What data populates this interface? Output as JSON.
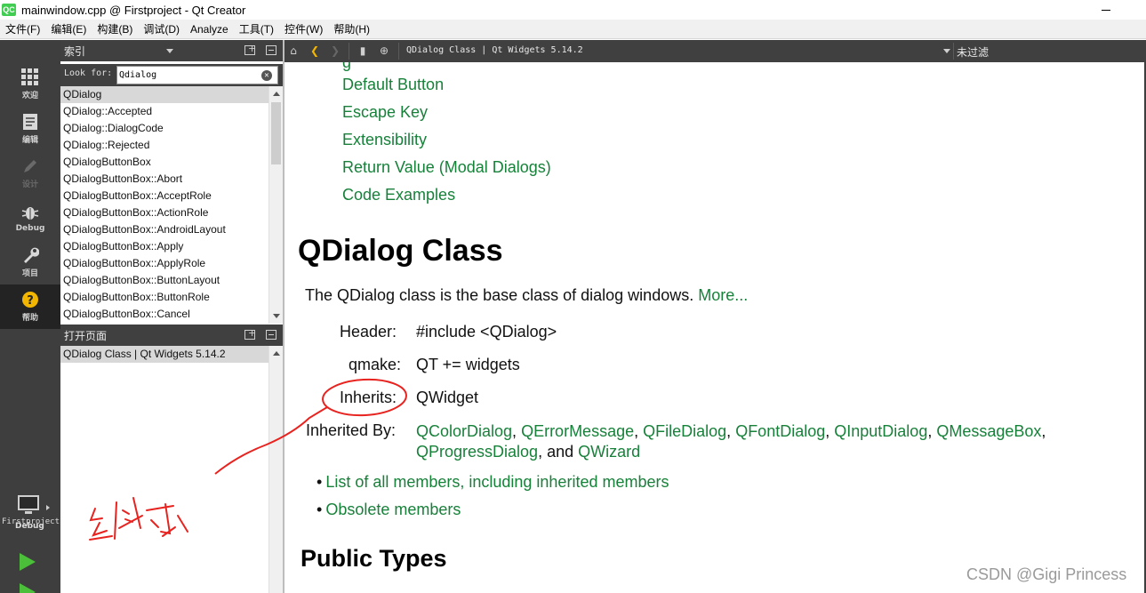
{
  "window": {
    "logo": "QC",
    "title": "mainwindow.cpp @ Firstproject - Qt Creator"
  },
  "menu": [
    "文件(F)",
    "编辑(E)",
    "构建(B)",
    "调试(D)",
    "Analyze",
    "工具(T)",
    "控件(W)",
    "帮助(H)"
  ],
  "modes": [
    {
      "label": "欢迎",
      "icon": "grid-icon"
    },
    {
      "label": "编辑",
      "icon": "document-icon"
    },
    {
      "label": "设计",
      "icon": "pencil-icon"
    },
    {
      "label": "Debug",
      "icon": "bug-icon"
    },
    {
      "label": "项目",
      "icon": "wrench-icon"
    },
    {
      "label": "帮助",
      "icon": "help-icon"
    }
  ],
  "target": {
    "project": "Firstproject",
    "build": "Debug"
  },
  "index_panel": {
    "title": "索引",
    "look_for_label": "Look for:",
    "search_value": "Qdialog",
    "items": [
      "QDialog",
      "QDialog::Accepted",
      "QDialog::DialogCode",
      "QDialog::Rejected",
      "QDialogButtonBox",
      "QDialogButtonBox::Abort",
      "QDialogButtonBox::AcceptRole",
      "QDialogButtonBox::ActionRole",
      "QDialogButtonBox::AndroidLayout",
      "QDialogButtonBox::Apply",
      "QDialogButtonBox::ApplyRole",
      "QDialogButtonBox::ButtonLayout",
      "QDialogButtonBox::ButtonRole",
      "QDialogButtonBox::Cancel"
    ]
  },
  "open_pages_panel": {
    "title": "打开页面",
    "items": [
      "QDialog Class | Qt Widgets 5.14.2"
    ]
  },
  "help_toolbar": {
    "doc_title": "QDialog Class | Qt Widgets 5.14.2",
    "filter": "未过滤"
  },
  "document": {
    "toc": [
      "Default Button",
      "Escape Key",
      "Extensibility",
      "Return Value (Modal Dialogs)",
      "Code Examples"
    ],
    "heading": "QDialog Class",
    "brief": "The QDialog class is the base class of dialog windows.",
    "more": "More...",
    "header_label": "Header:",
    "header_value": "#include <QDialog>",
    "qmake_label": "qmake:",
    "qmake_value": "QT += widgets",
    "inherits_label": "Inherits:",
    "inherits_value": "QWidget",
    "inherited_by_label": "Inherited By:",
    "inherited_by": [
      "QColorDialog",
      "QErrorMessage",
      "QFileDialog",
      "QFontDialog",
      "QInputDialog",
      "QMessageBox",
      "QProgressDialog"
    ],
    "inherited_by_and": "and",
    "inherited_by_last": "QWizard",
    "bullets": [
      "List of all members, including inherited members",
      "Obsolete members"
    ],
    "section": "Public Types"
  },
  "annotation": {
    "handwritten_note": "继承",
    "ink_color": "#e8231f"
  },
  "watermark": "CSDN @Gigi Princess"
}
